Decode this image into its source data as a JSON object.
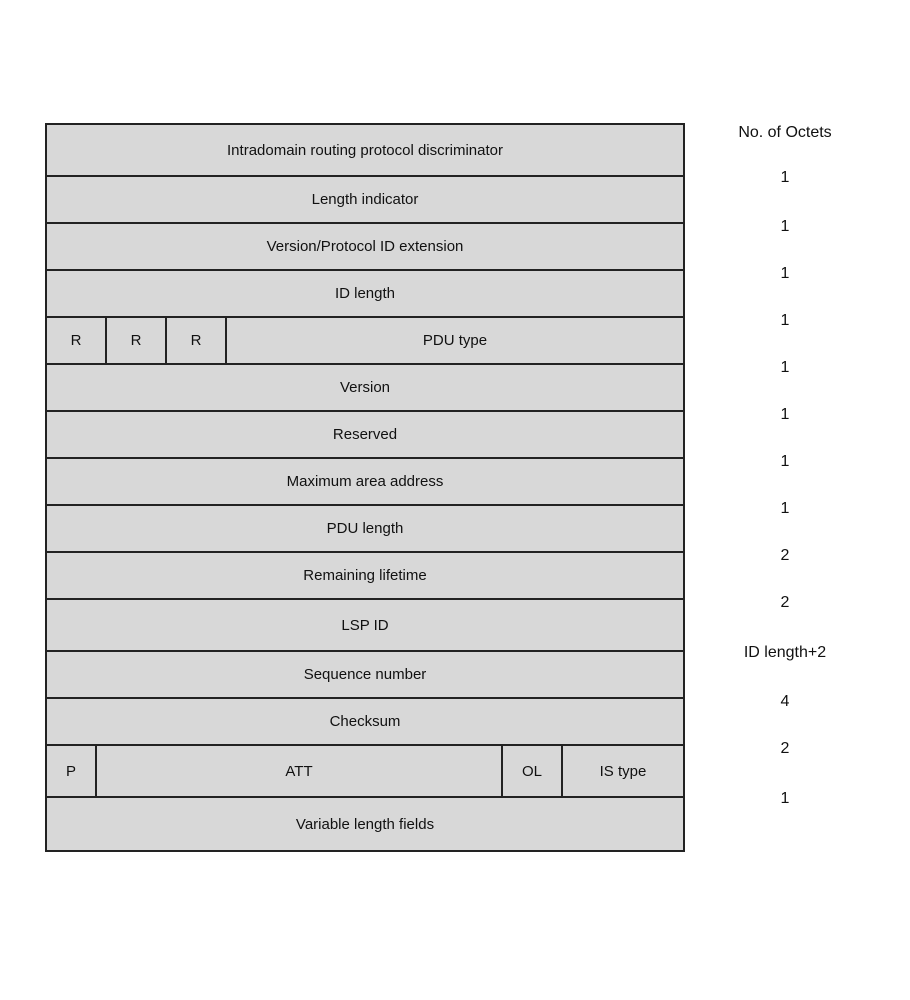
{
  "header": {
    "octets_label": "No. of Octets"
  },
  "rows": [
    {
      "id": "row-intradomain",
      "cells": [
        {
          "label": "Intradomain routing protocol discriminator",
          "flex": 1
        }
      ],
      "octets": "1"
    },
    {
      "id": "row-length-indicator",
      "cells": [
        {
          "label": "Length indicator",
          "flex": 1
        }
      ],
      "octets": "1"
    },
    {
      "id": "row-version-protocol",
      "cells": [
        {
          "label": "Version/Protocol ID extension",
          "flex": 1
        }
      ],
      "octets": "1"
    },
    {
      "id": "row-id-length",
      "cells": [
        {
          "label": "ID length",
          "flex": 1
        }
      ],
      "octets": "1"
    },
    {
      "id": "row-rrr-pdu",
      "cells": [
        {
          "label": "R",
          "flex": "0 0 60px"
        },
        {
          "label": "R",
          "flex": "0 0 60px"
        },
        {
          "label": "R",
          "flex": "0 0 60px"
        },
        {
          "label": "PDU type",
          "flex": 1
        }
      ],
      "octets": "1"
    },
    {
      "id": "row-version",
      "cells": [
        {
          "label": "Version",
          "flex": 1
        }
      ],
      "octets": "1"
    },
    {
      "id": "row-reserved",
      "cells": [
        {
          "label": "Reserved",
          "flex": 1
        }
      ],
      "octets": "1"
    },
    {
      "id": "row-max-area",
      "cells": [
        {
          "label": "Maximum area address",
          "flex": 1
        }
      ],
      "octets": "1"
    },
    {
      "id": "row-pdu-length",
      "cells": [
        {
          "label": "PDU length",
          "flex": 1
        }
      ],
      "octets": "2"
    },
    {
      "id": "row-remaining-lifetime",
      "cells": [
        {
          "label": "Remaining lifetime",
          "flex": 1
        }
      ],
      "octets": "2"
    },
    {
      "id": "row-lsp-id",
      "cells": [
        {
          "label": "LSP ID",
          "flex": 1
        }
      ],
      "octets": "ID length+2"
    },
    {
      "id": "row-sequence-number",
      "cells": [
        {
          "label": "Sequence number",
          "flex": 1
        }
      ],
      "octets": "4"
    },
    {
      "id": "row-checksum",
      "cells": [
        {
          "label": "Checksum",
          "flex": 1
        }
      ],
      "octets": "2"
    },
    {
      "id": "row-p-att-ol-istype",
      "cells": [
        {
          "label": "P",
          "flex": "0 0 50px"
        },
        {
          "label": "ATT",
          "flex": 1
        },
        {
          "label": "OL",
          "flex": "0 0 60px"
        },
        {
          "label": "IS type",
          "flex": "0 0 120px"
        }
      ],
      "octets": "1"
    },
    {
      "id": "row-variable-length",
      "cells": [
        {
          "label": "Variable length fields",
          "flex": 1
        }
      ],
      "octets": ""
    }
  ]
}
